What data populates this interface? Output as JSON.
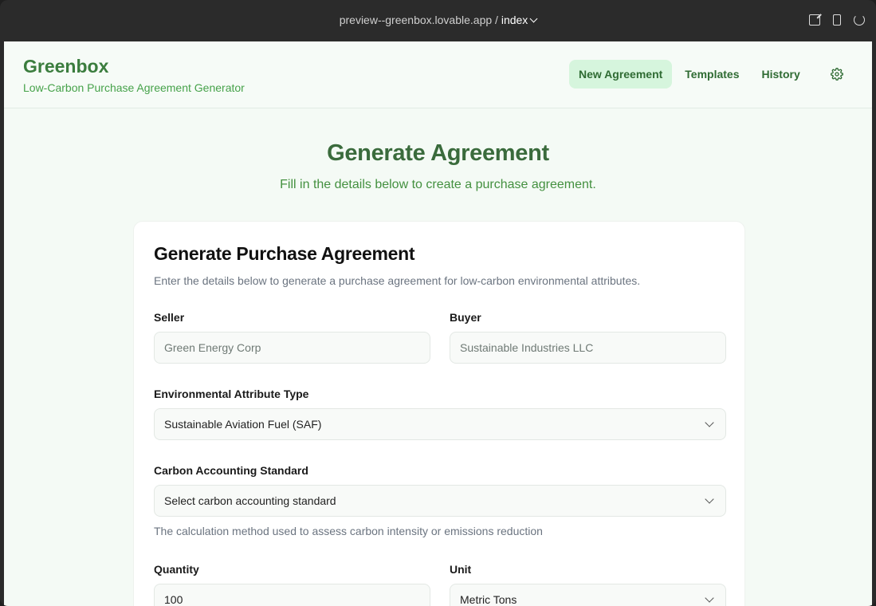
{
  "browser": {
    "url_host": "preview--greenbox.lovable.app / ",
    "url_page": "index"
  },
  "header": {
    "brand": "Greenbox",
    "tagline": "Low-Carbon Purchase Agreement Generator",
    "nav": [
      "New Agreement",
      "Templates",
      "History"
    ]
  },
  "hero": {
    "title": "Generate Agreement",
    "subtitle": "Fill in the details below to create a purchase agreement."
  },
  "form": {
    "title": "Generate Purchase Agreement",
    "description": "Enter the details below to generate a purchase agreement for low-carbon environmental attributes.",
    "seller_label": "Seller",
    "seller_placeholder": "Green Energy Corp",
    "buyer_label": "Buyer",
    "buyer_placeholder": "Sustainable Industries LLC",
    "attr_label": "Environmental Attribute Type",
    "attr_value": "Sustainable Aviation Fuel (SAF)",
    "standard_label": "Carbon Accounting Standard",
    "standard_value": "Select carbon accounting standard",
    "standard_help": "The calculation method used to assess carbon intensity or emissions reduction",
    "quantity_label": "Quantity",
    "quantity_value": "100",
    "unit_label": "Unit",
    "unit_value": "Metric Tons"
  },
  "colors": {
    "brand": "#3b7d3e",
    "accent_bg": "#d6f5dd",
    "page_bg": "#f4faf5"
  }
}
